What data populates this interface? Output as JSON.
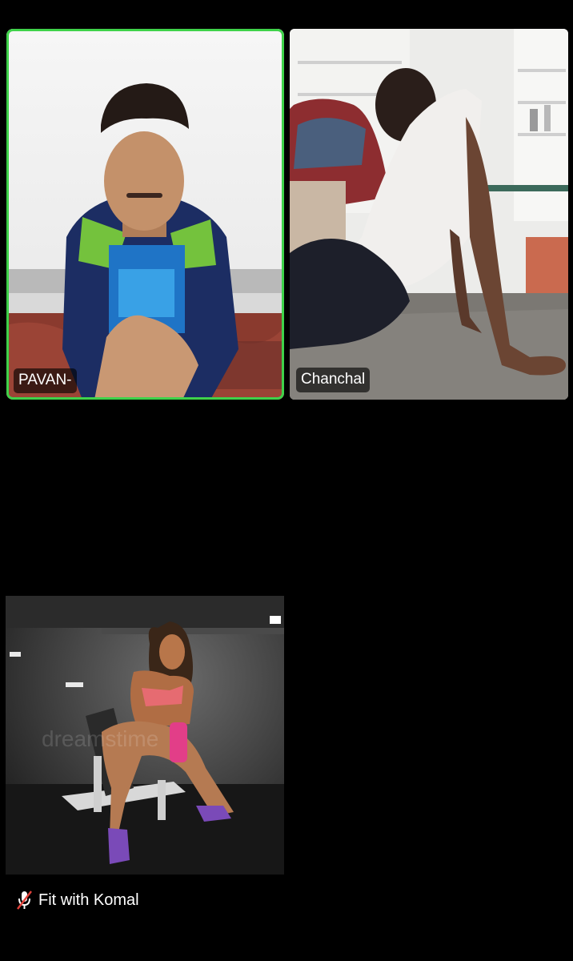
{
  "participants": [
    {
      "name": "PAVAN-",
      "active_speaker": true,
      "muted": false
    },
    {
      "name": "Chanchal",
      "active_speaker": false,
      "muted": false
    },
    {
      "name": "Fit with Komal",
      "active_speaker": false,
      "muted": true,
      "video_watermark": "dreamstime"
    }
  ],
  "colors": {
    "active_speaker_border": "#3fd24a",
    "muted_icon": "#e0413a",
    "background": "#000000"
  },
  "icons": {
    "muted": "microphone-off-icon"
  }
}
